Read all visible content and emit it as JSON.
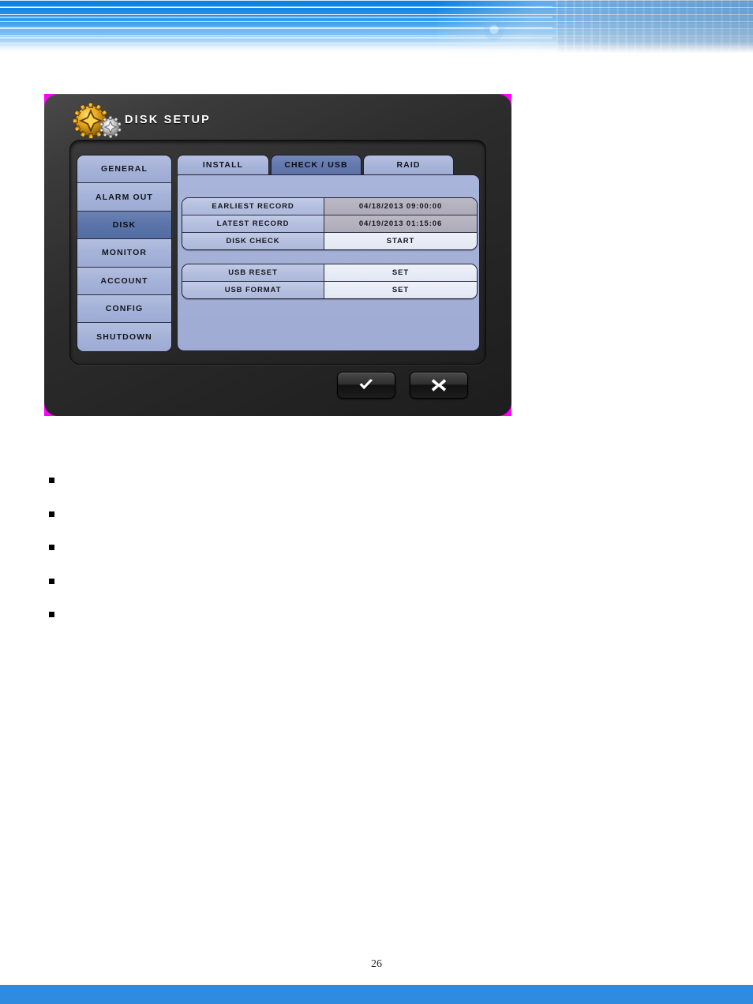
{
  "page": {
    "number": "26",
    "footer_accent_color": "#2e8be0",
    "banner_accent_color": "#0c7fe0"
  },
  "dialog": {
    "title": "DISK SETUP",
    "title_icon": "gears-icon",
    "key_color": "#ff00ff",
    "sidebar": {
      "items": [
        {
          "label": "GENERAL",
          "selected": false
        },
        {
          "label": "ALARM OUT",
          "selected": false
        },
        {
          "label": "DISK",
          "selected": true
        },
        {
          "label": "MONITOR",
          "selected": false
        },
        {
          "label": "ACCOUNT",
          "selected": false
        },
        {
          "label": "CONFIG",
          "selected": false
        },
        {
          "label": "SHUTDOWN",
          "selected": false
        }
      ],
      "selected_color": "#5a73a8",
      "normal_color": "#a5b2d8"
    },
    "tabs": [
      {
        "label": "INSTALL",
        "selected": false
      },
      {
        "label": "CHECK / USB",
        "selected": true
      },
      {
        "label": "RAID",
        "selected": false
      }
    ],
    "panel_color": "#a3afd6",
    "disk_table": {
      "rows": [
        {
          "label": "EARLIEST RECORD",
          "value": "04/18/2013 09:00:00",
          "kind": "readonly"
        },
        {
          "label": "LATEST RECORD",
          "value": "04/19/2013 01:15:06",
          "kind": "readonly"
        },
        {
          "label": "DISK CHECK",
          "value": "START",
          "kind": "action"
        }
      ]
    },
    "usb_table": {
      "rows": [
        {
          "label": "USB RESET",
          "value": "SET",
          "kind": "action"
        },
        {
          "label": "USB FORMAT",
          "value": "SET",
          "kind": "action"
        }
      ]
    },
    "buttons": [
      {
        "name": "confirm-button",
        "icon": "check-icon"
      },
      {
        "name": "cancel-button",
        "icon": "close-icon"
      }
    ]
  },
  "body": {
    "bullets": [
      {
        "text": ""
      },
      {
        "text": ""
      },
      {
        "text": ""
      },
      {
        "text": ""
      },
      {
        "text": ""
      }
    ]
  }
}
